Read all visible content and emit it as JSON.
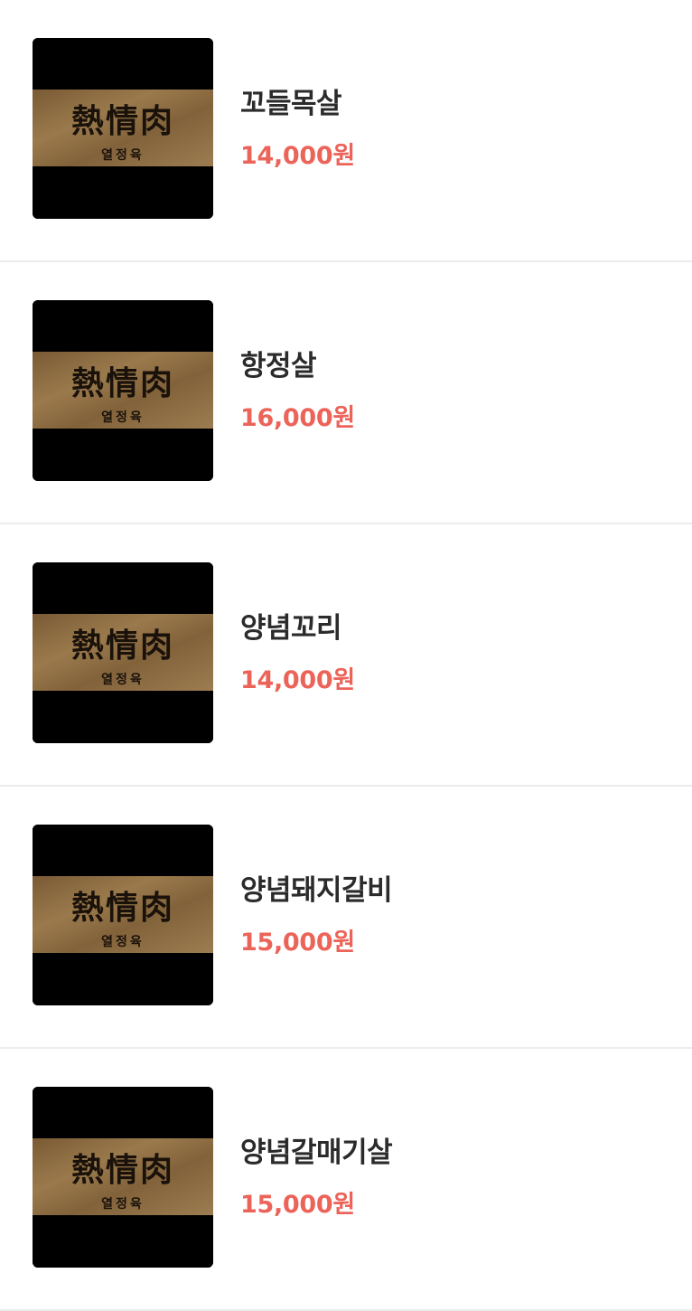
{
  "menu": {
    "items": [
      {
        "name": "꼬들목살",
        "price": "14,000원",
        "image": {
          "logo_main": "熱情肉",
          "logo_sub": "열정육"
        }
      },
      {
        "name": "항정살",
        "price": "16,000원",
        "image": {
          "logo_main": "熱情肉",
          "logo_sub": "열정육"
        }
      },
      {
        "name": "양념꼬리",
        "price": "14,000원",
        "image": {
          "logo_main": "熱情肉",
          "logo_sub": "열정육"
        }
      },
      {
        "name": "양념돼지갈비",
        "price": "15,000원",
        "image": {
          "logo_main": "熱情肉",
          "logo_sub": "열정육"
        }
      },
      {
        "name": "양념갈매기살",
        "price": "15,000원",
        "image": {
          "logo_main": "熱情肉",
          "logo_sub": "열정육"
        }
      }
    ]
  },
  "colors": {
    "price": "#ec6459",
    "name": "#2b2b2b",
    "divider": "#ececec",
    "logo_band": "#8b6a40"
  }
}
